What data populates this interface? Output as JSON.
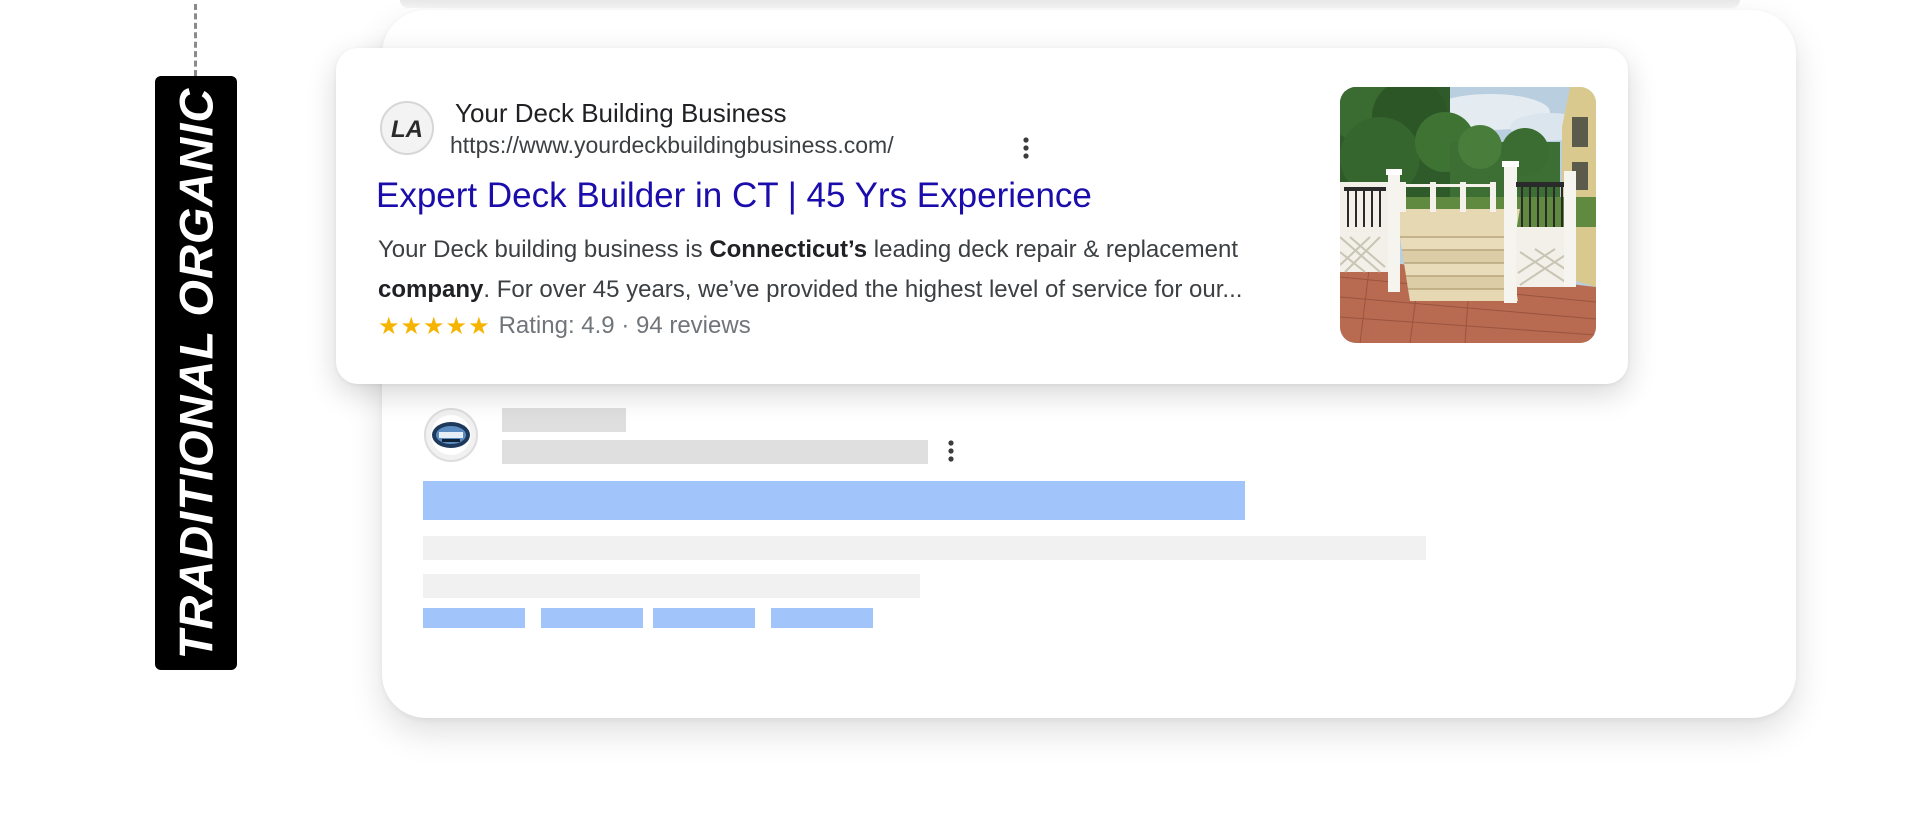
{
  "side_label": "TRADITIONAL ORGANIC",
  "result": {
    "favicon_text": "LA",
    "site_name": "Your Deck Building Business",
    "url": "https://www.yourdeckbuildingbusiness.com/",
    "title": "Expert Deck Builder in CT | 45 Yrs Experience",
    "snippet": {
      "part1": "Your Deck building business is ",
      "bold1": "Connecticut’s",
      "part2": " leading deck repair & replacement",
      "bold2": "company",
      "part3": ". For over 45 years, we’ve provided the highest level of service for our..."
    },
    "stars": "★★★★★",
    "rating_text": "Rating: 4.9 · 94 reviews",
    "rating_value": 4.9,
    "review_count": 94
  },
  "icons": {
    "favicon": "la-logo-icon",
    "more": "more-vert-icon",
    "thumbnail": "deck-photo",
    "placeholder_avatar": "business-logo-icon"
  },
  "colors": {
    "title_link": "#1a0dab",
    "star": "#f6b400",
    "placeholder_gray": "#dfdfdf",
    "placeholder_light": "#f1f1f1",
    "placeholder_blue": "#a1c4fa",
    "side_label_bg": "#000000"
  }
}
